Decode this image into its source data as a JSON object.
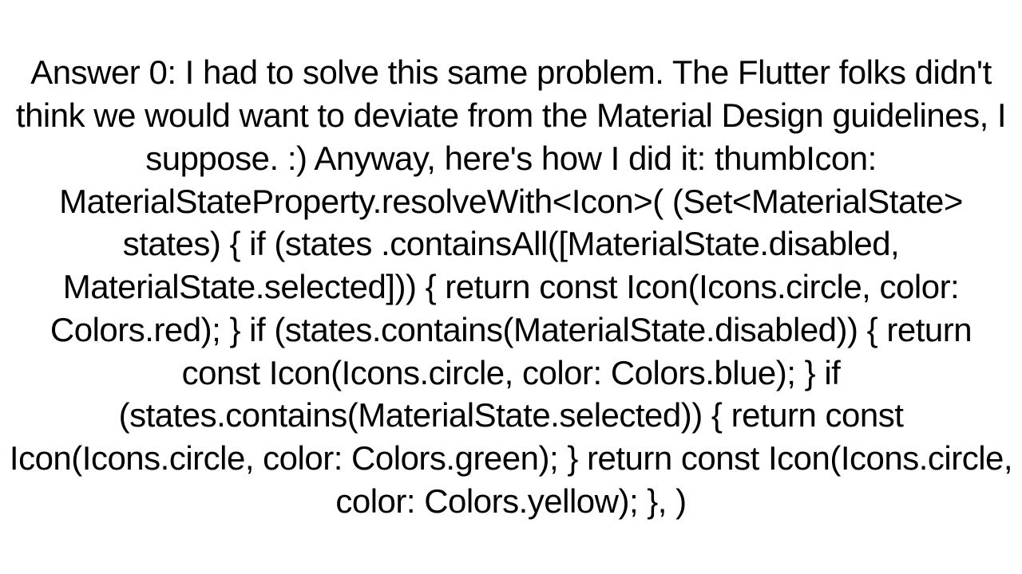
{
  "answer": {
    "text": "Answer 0: I had to solve this same problem. The Flutter folks didn't think we would want to deviate from the Material Design guidelines, I suppose. :) Anyway, here's how I did it: thumbIcon: MaterialStateProperty.resolveWith<Icon>(   (Set<MaterialState> states) {     if (states         .containsAll([MaterialState.disabled, MaterialState.selected])) {       return const Icon(Icons.circle, color: Colors.red);     }     if (states.contains(MaterialState.disabled)) {       return const Icon(Icons.circle, color: Colors.blue);     }     if (states.contains(MaterialState.selected)) {       return const Icon(Icons.circle, color: Colors.green);     }     return const Icon(Icons.circle, color: Colors.yellow);   }, )"
  }
}
